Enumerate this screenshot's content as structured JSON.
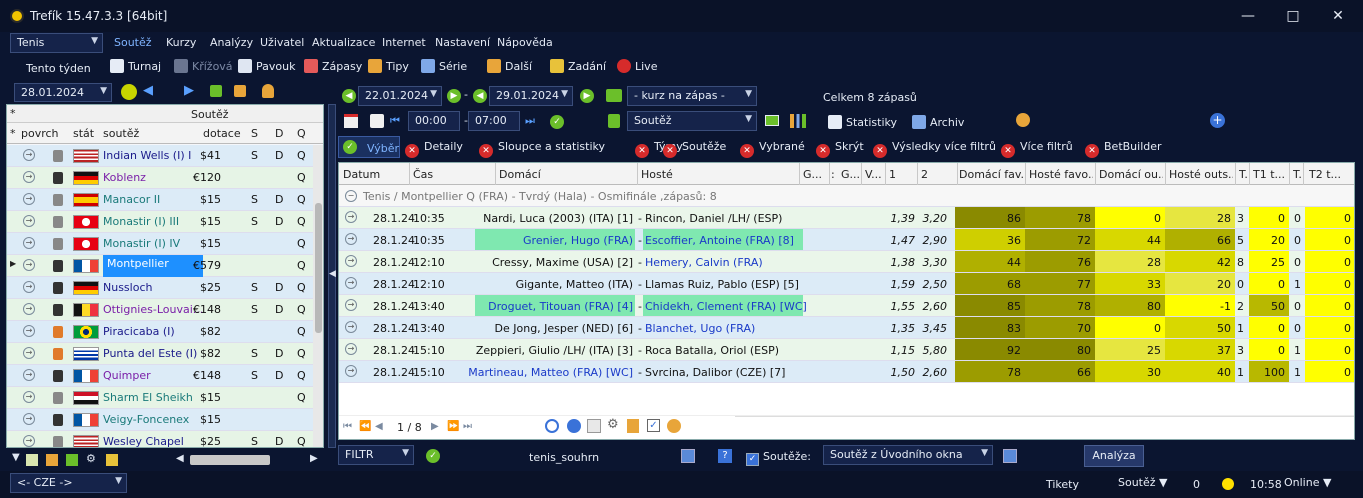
{
  "window": {
    "title": "Trefík 15.47.3.3 [64bit]"
  },
  "sport_select": "Tenis",
  "menu": [
    "Soutěž",
    "Kurzy",
    "Analýzy",
    "Uživatel",
    "Aktualizace",
    "Internet",
    "Nastavení",
    "Nápověda"
  ],
  "week_label": "Tento týden",
  "date_left": "28.01.2024",
  "toolbar": {
    "turnaj": "Turnaj",
    "krizova": "Křížová",
    "pavouk": "Pavouk",
    "zapasy": "Zápasy",
    "tipy": "Tipy",
    "serie": "Série",
    "dalsi": "Další",
    "zadani": "Zadání",
    "live": "Live"
  },
  "range": {
    "from": "22.01.2024",
    "to": "29.01.2024",
    "kurz": "- kurz na zápas -",
    "total": "Celkem 8 zápasů"
  },
  "time": {
    "from": "00:00",
    "to": "07:00",
    "sep": "-"
  },
  "soutez_select": "Soutěž",
  "statistiky": "Statistiky",
  "archiv": "Archiv",
  "filters": {
    "vyber": "Výběr",
    "detaily": "Detaily",
    "sloupce": "Sloupce a statistiky",
    "tymy": "Týmy",
    "souteze": "Soutěže",
    "vybrane": "Vybrané",
    "skryt": "Skrýt",
    "vysledky": "Výsledky více filtrů",
    "vice": "Více filtrů",
    "betbuilder": "BetBuilder"
  },
  "left_panel": {
    "header": "Soutěž",
    "star": "*",
    "cols": {
      "povrch": "povrch",
      "stat": "stát",
      "soutez": "soutěž",
      "dotace": "dotace",
      "s": "S",
      "d": "D",
      "q": "Q"
    },
    "rows": [
      {
        "name": "Indian Wells (I) I",
        "dotace": "$41",
        "s": "S",
        "d": "D",
        "q": "Q",
        "color": "#1a1a8a",
        "flag": "us",
        "surface": "#888888",
        "bg": "#dcebf7"
      },
      {
        "name": "Koblenz",
        "dotace": "€120",
        "s": "",
        "d": "",
        "q": "Q",
        "color": "#7a1fa8",
        "flag": "de",
        "surface": "#333333",
        "bg": "#e6f4e6"
      },
      {
        "name": "Manacor II",
        "dotace": "$15",
        "s": "S",
        "d": "D",
        "q": "Q",
        "color": "#1a7a7a",
        "flag": "es",
        "surface": "#888888",
        "bg": "#dcebf7"
      },
      {
        "name": "Monastir (I) III",
        "dotace": "$15",
        "s": "S",
        "d": "D",
        "q": "Q",
        "color": "#1a7a7a",
        "flag": "tn",
        "surface": "#888888",
        "bg": "#e6f4e6"
      },
      {
        "name": "Monastir (I) IV",
        "dotace": "$15",
        "s": "",
        "d": "",
        "q": "Q",
        "color": "#1a7a7a",
        "flag": "tn",
        "surface": "#888888",
        "bg": "#dcebf7"
      },
      {
        "name": "Montpellier",
        "dotace": "€579",
        "s": "",
        "d": "",
        "q": "Q",
        "color": "#ffffff",
        "flag": "fr",
        "surface": "#333333",
        "bg": "#e6f4e6",
        "selected": true
      },
      {
        "name": "Nussloch",
        "dotace": "$25",
        "s": "S",
        "d": "D",
        "q": "Q",
        "color": "#1a1a8a",
        "flag": "de",
        "surface": "#333333",
        "bg": "#dcebf7"
      },
      {
        "name": "Ottignies-Louvai...",
        "dotace": "€148",
        "s": "S",
        "d": "D",
        "q": "Q",
        "color": "#7a1fa8",
        "flag": "be",
        "surface": "#333333",
        "bg": "#e6f4e6"
      },
      {
        "name": "Piracicaba (I)",
        "dotace": "$82",
        "s": "",
        "d": "",
        "q": "Q",
        "color": "#1a1a8a",
        "flag": "br",
        "surface": "#e07a2a",
        "bg": "#dcebf7"
      },
      {
        "name": "Punta del Este (I)",
        "dotace": "$82",
        "s": "S",
        "d": "D",
        "q": "Q",
        "color": "#1a1a8a",
        "flag": "uy",
        "surface": "#e07a2a",
        "bg": "#e6f4e6"
      },
      {
        "name": "Quimper",
        "dotace": "€148",
        "s": "S",
        "d": "D",
        "q": "Q",
        "color": "#7a1fa8",
        "flag": "fr",
        "surface": "#333333",
        "bg": "#dcebf7"
      },
      {
        "name": "Sharm El Sheikh",
        "dotace": "$15",
        "s": "",
        "d": "",
        "q": "Q",
        "color": "#1a7a7a",
        "flag": "eg",
        "surface": "#888888",
        "bg": "#e6f4e6"
      },
      {
        "name": "Veigy-Foncenex",
        "dotace": "$15",
        "s": "",
        "d": "",
        "q": "",
        "color": "#1a7a7a",
        "flag": "fr",
        "surface": "#333333",
        "bg": "#dcebf7"
      },
      {
        "name": "Wesley Chapel",
        "dotace": "$25",
        "s": "S",
        "d": "D",
        "q": "Q",
        "color": "#1a1a8a",
        "flag": "us",
        "surface": "#888888",
        "bg": "#e6f4e6"
      }
    ]
  },
  "grid": {
    "cols": [
      "Datum",
      "Čas",
      "Domácí",
      "Hosté",
      "G...",
      "G...",
      "V...",
      "1",
      "2",
      "Domácí fav...",
      "Hosté favo...",
      "Domácí ou...",
      "Hosté outs...",
      "T...",
      "T1 t...",
      "T...",
      "T2 t..."
    ],
    "group": "Tenis / Montpellier Q (FRA) - Tvrdý (Hala) - Osmifinále ,zápasů: 8",
    "rows": [
      {
        "datum": "28.1.24",
        "cas": "10:35",
        "home": "Nardi, Luca (2003) (ITA) [1]",
        "away": "Rincon, Daniel /LH/ (ESP)",
        "o1": "1,39",
        "o2": "3,20",
        "df": "86",
        "hf": "78",
        "do": "0",
        "ho": "28",
        "t": "3",
        "t1": "0",
        "tt": "0",
        "t2": "0",
        "hl": false,
        "blue": false,
        "bg": "#eaf6ea"
      },
      {
        "datum": "28.1.24",
        "cas": "10:35",
        "home": "Grenier, Hugo (FRA)",
        "away": "Escoffier, Antoine (FRA) [8]",
        "o1": "1,47",
        "o2": "2,90",
        "df": "36",
        "hf": "72",
        "do": "44",
        "ho": "66",
        "t": "5",
        "t1": "20",
        "tt": "0",
        "t2": "0",
        "hl": true,
        "blue": true,
        "bg": "#dcebf7"
      },
      {
        "datum": "28.1.24",
        "cas": "12:10",
        "home": "Cressy, Maxime (USA) [2]",
        "away": "Hemery, Calvin (FRA)",
        "o1": "1,38",
        "o2": "3,30",
        "df": "44",
        "hf": "76",
        "do": "28",
        "ho": "42",
        "t": "8",
        "t1": "25",
        "tt": "0",
        "t2": "0",
        "hl": false,
        "blue": false,
        "awayblue": true,
        "bg": "#eaf6ea"
      },
      {
        "datum": "28.1.24",
        "cas": "12:10",
        "home": "Gigante, Matteo (ITA)",
        "away": "Llamas Ruiz, Pablo (ESP) [5]",
        "o1": "1,59",
        "o2": "2,50",
        "df": "68",
        "hf": "77",
        "do": "33",
        "ho": "20",
        "t": "0",
        "t1": "0",
        "tt": "1",
        "t2": "0",
        "hl": false,
        "blue": false,
        "bg": "#dcebf7"
      },
      {
        "datum": "28.1.24",
        "cas": "13:40",
        "home": "Droguet, Titouan (FRA) [4]",
        "away": "Chidekh, Clement (FRA) [WC]",
        "o1": "1,55",
        "o2": "2,60",
        "df": "85",
        "hf": "78",
        "do": "80",
        "ho": "-1",
        "t": "2",
        "t1": "50",
        "tt": "0",
        "t2": "0",
        "hl": true,
        "blue": true,
        "bg": "#eaf6ea"
      },
      {
        "datum": "28.1.24",
        "cas": "13:40",
        "home": "De Jong, Jesper (NED) [6]",
        "away": "Blanchet, Ugo (FRA)",
        "o1": "1,35",
        "o2": "3,45",
        "df": "83",
        "hf": "70",
        "do": "0",
        "ho": "50",
        "t": "1",
        "t1": "0",
        "tt": "0",
        "t2": "0",
        "hl": false,
        "blue": false,
        "awayblue": true,
        "bg": "#dcebf7"
      },
      {
        "datum": "28.1.24",
        "cas": "15:10",
        "home": "Zeppieri, Giulio /LH/ (ITA) [3]",
        "away": "Roca Batalla, Oriol (ESP)",
        "o1": "1,15",
        "o2": "5,80",
        "df": "92",
        "hf": "80",
        "do": "25",
        "ho": "37",
        "t": "3",
        "t1": "0",
        "tt": "1",
        "t2": "0",
        "hl": false,
        "blue": false,
        "bg": "#eaf6ea"
      },
      {
        "datum": "28.1.24",
        "cas": "15:10",
        "home": "Martineau, Matteo (FRA) [WC]",
        "away": "Svrcina, Dalibor (CZE) [7]",
        "o1": "1,50",
        "o2": "2,60",
        "df": "78",
        "hf": "66",
        "do": "30",
        "ho": "40",
        "t": "1",
        "t1": "100",
        "tt": "1",
        "t2": "0",
        "hl": false,
        "blue": false,
        "homeblue": true,
        "bg": "#dcebf7"
      }
    ],
    "pager": "1 / 8"
  },
  "bottom": {
    "filtr": "FILTR",
    "filter_name": "tenis_souhrn",
    "souteze_label": "Soutěže:",
    "souteze_select": "Soutěž z Úvodního okna",
    "analyza": "Analýza"
  },
  "status": {
    "country": "<- CZE ->",
    "tikety": "Tikety",
    "soutez": "Soutěž",
    "count": "0",
    "time": "10:58",
    "online": "Online"
  },
  "colors": {
    "olive": "#8a8a00",
    "olive2": "#b0b000",
    "yellow": "#ffff00",
    "yellow2": "#e6e640",
    "mint": "#7fe8b0",
    "accent": "#3a72d8"
  }
}
